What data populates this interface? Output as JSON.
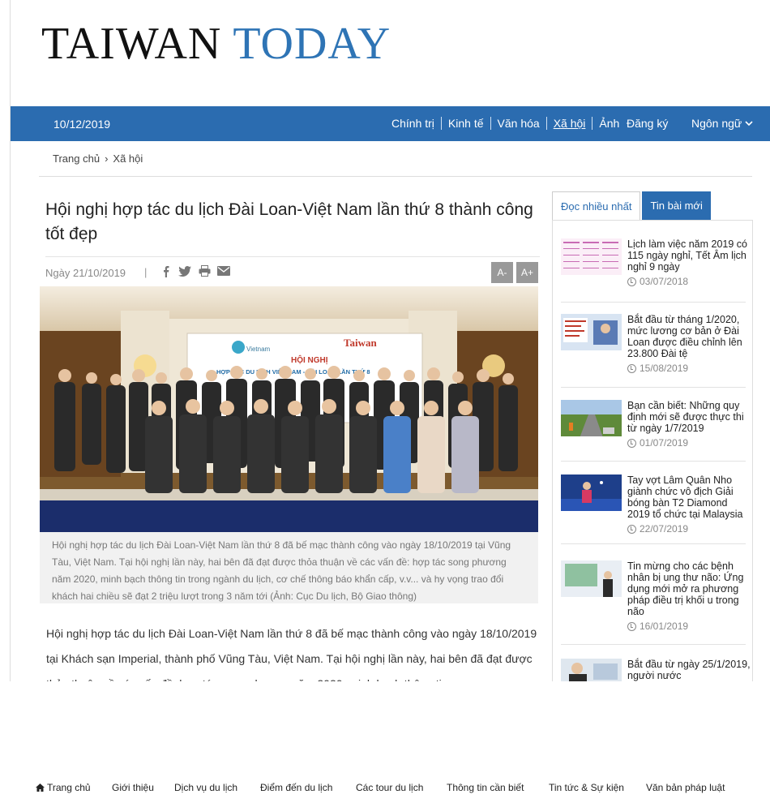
{
  "logo": {
    "word1": "TAIWAN",
    "word2": "TODAY"
  },
  "colors": {
    "brand_blue": "#2b6cb0",
    "logo_blue": "#2e74b5"
  },
  "navbar": {
    "date": "10/12/2019",
    "menu": [
      "Chính trị",
      "Kinh tế",
      "Văn hóa",
      "Xã hội",
      "Ảnh"
    ],
    "active": "Xã hội",
    "signup": "Đăng ký",
    "language": "Ngôn ngữ"
  },
  "breadcrumb": {
    "home": "Trang chủ",
    "separator": "›",
    "current": "Xã hội"
  },
  "article": {
    "title": "Hội nghị hợp tác du lịch Đài Loan-Việt Nam lần thứ 8 thành công tốt đẹp",
    "date": "Ngày 21/10/2019",
    "font_minus": "A-",
    "font_plus": "A+",
    "share_icons": [
      "facebook-icon",
      "twitter-icon",
      "print-icon",
      "email-icon"
    ],
    "photo": {
      "banner_heading": "HỘI NGHỊ",
      "banner_line": "HỢP TÁC DU LỊCH VIỆT NAM - ĐÀI LOAN LẦN THỨ 8",
      "banner_brand": "Taiwan",
      "banner_logo": "Vietnam"
    },
    "caption": "Hội nghị hợp tác du lịch Đài Loan-Việt Nam lần thứ 8 đã bế mạc thành công vào ngày 18/10/2019 tại Vũng Tàu, Việt Nam. Tại hội nghị lần này, hai bên đã đạt được thỏa thuận về các vấn đề: hợp tác song phương năm 2020, minh bạch thông tin trong ngành du lịch, cơ chế thông báo khẩn cấp, v.v... và hy vọng trao đổi khách hai chiều sẽ đạt 2 triệu lượt trong 3 năm tới (Ảnh: Cục Du lịch, Bộ Giao thông)",
    "body": "Hội nghị hợp tác du lịch Đài Loan-Việt Nam lần thứ 8 đã bế mạc thành công vào ngày 18/10/2019 tại Khách sạn Imperial, thành phố Vũng Tàu, Việt Nam. Tại hội nghị lần này, hai bên đã đạt được thỏa thuận về các vấn đề: hợp tác song phương năm 2020, minh bạch thông tin"
  },
  "sidebar": {
    "tab_popular": "Đọc nhiều nhất",
    "tab_latest": "Tin bài mới",
    "items": [
      {
        "title": "Lịch làm việc năm 2019 có 115 ngày nghỉ, Tết Âm lịch nghỉ 9 ngày",
        "date": "03/07/2018"
      },
      {
        "title": "Bắt đầu từ tháng 1/2020, mức lương cơ bản ở Đài Loan được điều chỉnh lên 23.800 Đài tệ",
        "date": "15/08/2019"
      },
      {
        "title": "Bạn cần biết: Những quy định mới sẽ được thực thi từ ngày 1/7/2019",
        "date": "01/07/2019"
      },
      {
        "title": "Tay vợt Lâm Quân Nho giành chức vô địch Giải bóng bàn T2 Diamond 2019 tổ chức tại Malaysia",
        "date": "22/07/2019"
      },
      {
        "title": "Tin mừng cho các bệnh nhân bị ung thư não: Ứng dụng mới mở ra phương pháp điều trị khối u trong não",
        "date": "16/01/2019"
      },
      {
        "title": "Bắt đầu từ ngày 25/1/2019, người nước",
        "date": ""
      }
    ]
  },
  "footer": {
    "items": [
      "Trang chủ",
      "Giới thiệu",
      "Dịch vụ du lịch",
      "Điểm đến du lịch",
      "Các tour du lịch",
      "Thông tin cần biết",
      "Tin tức & Sự kiện",
      "Văn bản pháp luật"
    ]
  }
}
